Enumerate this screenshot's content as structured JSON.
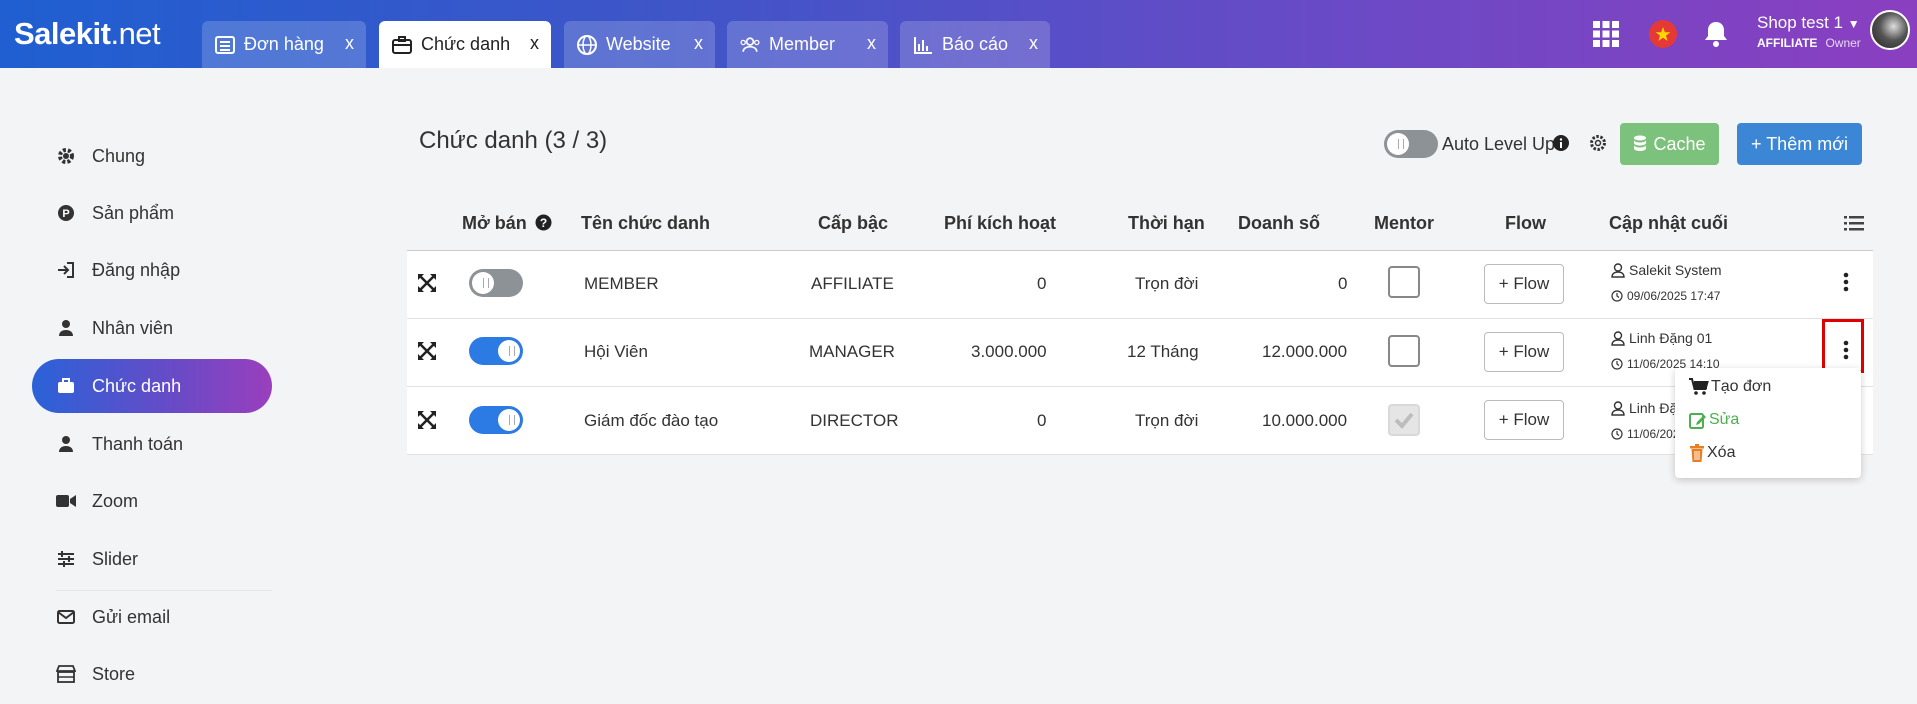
{
  "brand": {
    "logo_main": "Salekit",
    "logo_suffix": ".net"
  },
  "tabs": [
    {
      "label": "Đơn hàng",
      "close": "x",
      "icon": "list-icon"
    },
    {
      "label": "Chức danh",
      "close": "x",
      "icon": "briefcase-icon"
    },
    {
      "label": "Website",
      "close": "x",
      "icon": "globe-icon"
    },
    {
      "label": "Member",
      "close": "x",
      "icon": "users-icon"
    },
    {
      "label": "Báo cáo",
      "close": "x",
      "icon": "chart-icon"
    }
  ],
  "user": {
    "name": "Shop test 1",
    "role": "AFFILIATE",
    "title": "Owner"
  },
  "sidebar": {
    "items": [
      {
        "label": "Chung",
        "icon": "gear-icon"
      },
      {
        "label": "Sản phẩm",
        "icon": "product-icon"
      },
      {
        "label": "Đăng nhập",
        "icon": "login-icon"
      },
      {
        "label": "Nhân viên",
        "icon": "user-icon"
      },
      {
        "label": "Chức danh",
        "icon": "briefcase-icon"
      },
      {
        "label": "Thanh toán",
        "icon": "user-icon"
      },
      {
        "label": "Zoom",
        "icon": "video-icon"
      },
      {
        "label": "Slider",
        "icon": "sliders-icon"
      },
      {
        "label": "Gửi email",
        "icon": "mail-icon"
      },
      {
        "label": "Store",
        "icon": "store-icon"
      }
    ]
  },
  "main": {
    "title": "Chức danh (3 / 3)",
    "auto_level_up": "Auto Level Up",
    "cache_label": "Cache",
    "add_label": "+ Thêm mới"
  },
  "table": {
    "headers": {
      "mo_ban": "Mở bán",
      "ten": "Tên chức danh",
      "cap_bac": "Cấp bậc",
      "phi": "Phí kích hoạt",
      "thoi_han": "Thời hạn",
      "doanh_so": "Doanh số",
      "mentor": "Mentor",
      "flow": "Flow",
      "cap_nhat": "Cập nhật cuối"
    },
    "rows": [
      {
        "enabled": false,
        "name": "MEMBER",
        "level": "AFFILIATE",
        "fee": "0",
        "term": "Trọn đời",
        "sales": "0",
        "mentor": false,
        "flow": "+ Flow",
        "updater": "Salekit System",
        "time": "09/06/2025 17:47"
      },
      {
        "enabled": true,
        "name": "Hội Viên",
        "level": "MANAGER",
        "fee": "3.000.000",
        "term": "12 Tháng",
        "sales": "12.000.000",
        "mentor": false,
        "flow": "+ Flow",
        "updater": "Linh Đặng 01",
        "time": "11/06/2025 14:10"
      },
      {
        "enabled": true,
        "name": "Giám đốc đào tạo",
        "level": "DIRECTOR",
        "fee": "0",
        "term": "Trọn đời",
        "sales": "10.000.000",
        "mentor": true,
        "flow": "+ Flow",
        "updater": "Linh Đặ",
        "time": "11/06/2025"
      }
    ]
  },
  "menu": {
    "create": "Tạo đơn",
    "edit": "Sửa",
    "delete": "Xóa"
  },
  "colors": {
    "accent": "#2c7be5",
    "cache": "#7cc17c",
    "add": "#3b87d6",
    "edit": "#4caf50",
    "delete": "#e67e22",
    "highlight": "#e00000"
  }
}
